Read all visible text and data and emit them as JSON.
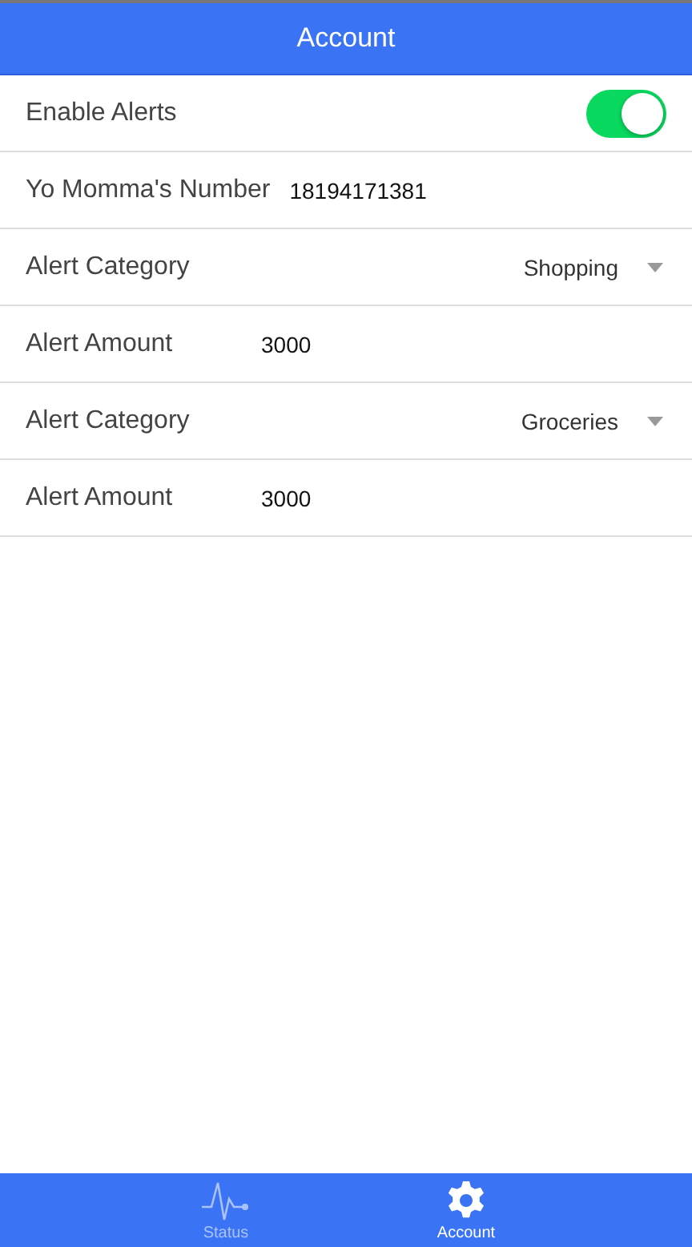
{
  "header": {
    "title": "Account"
  },
  "rows": [
    {
      "kind": "toggle",
      "label": "Enable Alerts",
      "on": true
    },
    {
      "kind": "input",
      "label": "Yo Momma's Number",
      "value": "18194171381"
    },
    {
      "kind": "select",
      "label": "Alert Category",
      "value": "Shopping"
    },
    {
      "kind": "input",
      "label": "Alert Amount",
      "value": "3000"
    },
    {
      "kind": "select",
      "label": "Alert Category",
      "value": "Groceries"
    },
    {
      "kind": "input",
      "label": "Alert Amount",
      "value": "3000"
    }
  ],
  "tabs": [
    {
      "label": "Status",
      "kind": "pulse",
      "selected": false
    },
    {
      "label": "Account",
      "kind": "gear",
      "selected": true
    }
  ]
}
